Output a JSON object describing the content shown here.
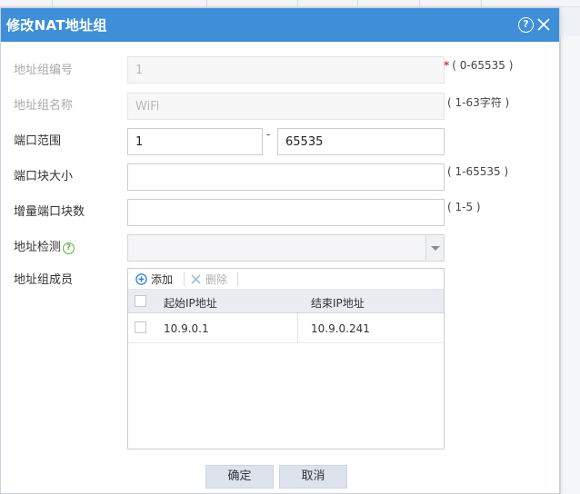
{
  "dialog": {
    "title": "修改NAT地址组",
    "help_glyph": "?"
  },
  "fields": {
    "group_id": {
      "label": "地址组编号",
      "value": "1",
      "required_mark": "*",
      "hint": "( 0-65535 )"
    },
    "group_name": {
      "label": "地址组名称",
      "value": "WiFi",
      "hint": "( 1-63字符 )"
    },
    "port_range": {
      "label": "端口范围",
      "start": "1",
      "separator": "-",
      "end": "65535"
    },
    "port_block_size": {
      "label": "端口块大小",
      "value": "",
      "hint": "( 1-65535 )"
    },
    "incremental_blocks": {
      "label": "增量端口块数",
      "value": "",
      "hint": "( 1-5 )"
    },
    "address_check": {
      "label": "地址检测",
      "help_glyph": "?",
      "selected": ""
    },
    "members": {
      "label": "地址组成员"
    }
  },
  "members_toolbar": {
    "add_label": "添加",
    "delete_label": "删除"
  },
  "members_table": {
    "columns": [
      "起始IP地址",
      "结束IP地址"
    ],
    "rows": [
      {
        "start_ip": "10.9.0.1",
        "end_ip": "10.9.0.241"
      }
    ]
  },
  "buttons": {
    "ok": "确定",
    "cancel": "取消"
  },
  "colors": {
    "titlebar": "#3f8fd8",
    "required": "#e4393c",
    "help_green": "#58b53a",
    "add_blue": "#2f7fd1"
  }
}
